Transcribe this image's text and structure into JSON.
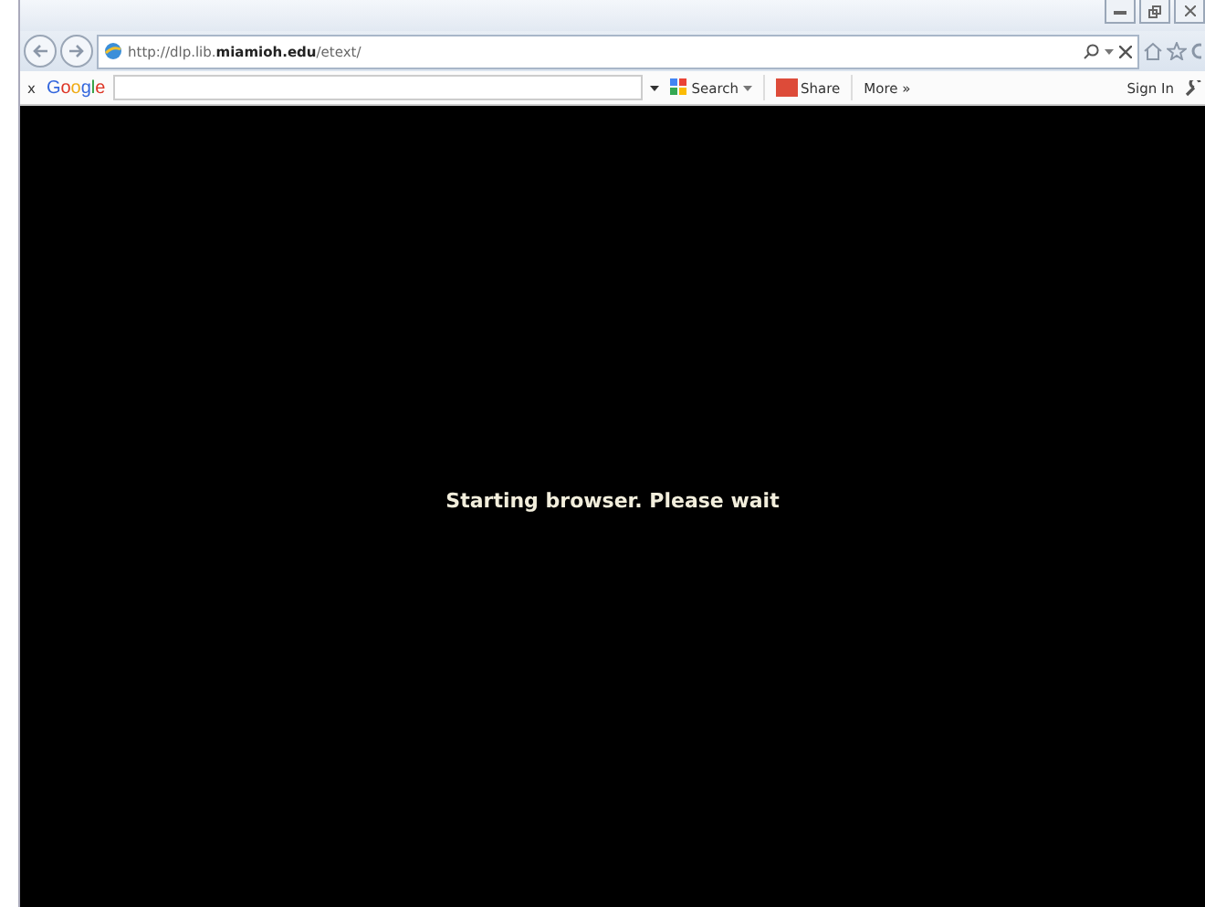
{
  "address_bar": {
    "url": "http://dlp.lib.**miamioh.edu**/etext/"
  },
  "google_toolbar": {
    "close": "x",
    "logo": "Google",
    "search": "Search",
    "share": "Share",
    "more": "More »",
    "sign_in": "Sign In"
  },
  "content": {
    "message": "Starting browser. Please wait"
  }
}
